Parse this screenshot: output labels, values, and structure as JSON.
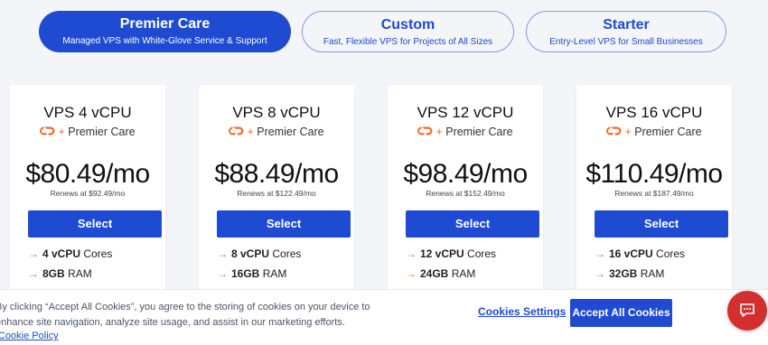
{
  "tabs": [
    {
      "title": "Premier Care",
      "subtitle": "Managed VPS with White-Glove Service & Support"
    },
    {
      "title": "Custom",
      "subtitle": "Fast, Flexible VPS for Projects of All Sizes"
    },
    {
      "title": "Starter",
      "subtitle": "Entry-Level VPS for Small Businesses"
    }
  ],
  "brand": {
    "plus": "+",
    "text": "Premier Care",
    "logo_color": "#ef6c2d"
  },
  "plans": [
    {
      "name": "VPS 4 vCPU",
      "price": "$80.49",
      "unit": "/mo",
      "renew": "Renews at $92.49/mo",
      "select": "Select",
      "features": [
        {
          "bold": "4 vCPU",
          "rest": "Cores"
        },
        {
          "bold": "8GB",
          "rest": "RAM"
        }
      ]
    },
    {
      "name": "VPS 8 vCPU",
      "price": "$88.49",
      "unit": "/mo",
      "renew": "Renews at $122.49/mo",
      "select": "Select",
      "features": [
        {
          "bold": "8 vCPU",
          "rest": "Cores"
        },
        {
          "bold": "16GB",
          "rest": "RAM"
        }
      ]
    },
    {
      "name": "VPS 12 vCPU",
      "price": "$98.49",
      "unit": "/mo",
      "renew": "Renews at $152.49/mo",
      "select": "Select",
      "features": [
        {
          "bold": "12 vCPU",
          "rest": "Cores"
        },
        {
          "bold": "24GB",
          "rest": "RAM"
        }
      ]
    },
    {
      "name": "VPS 16 vCPU",
      "price": "$110.49",
      "unit": "/mo",
      "renew": "Renews at $187.49/mo",
      "select": "Select",
      "features": [
        {
          "bold": "16 vCPU",
          "rest": "Cores"
        },
        {
          "bold": "32GB",
          "rest": "RAM"
        }
      ]
    }
  ],
  "arrow": "→",
  "cookie": {
    "text": "By clicking “Accept All Cookies”, you agree to the storing of cookies on your device to enhance site navigation, analyze site usage, and assist in our marketing efforts.",
    "policy": "Cookie Policy",
    "settings": "Cookies Settings",
    "accept": "Accept All Cookies"
  },
  "colors": {
    "accent": "#1e4bd1",
    "orange": "#ef6c2d",
    "chat": "#d32f2f"
  }
}
